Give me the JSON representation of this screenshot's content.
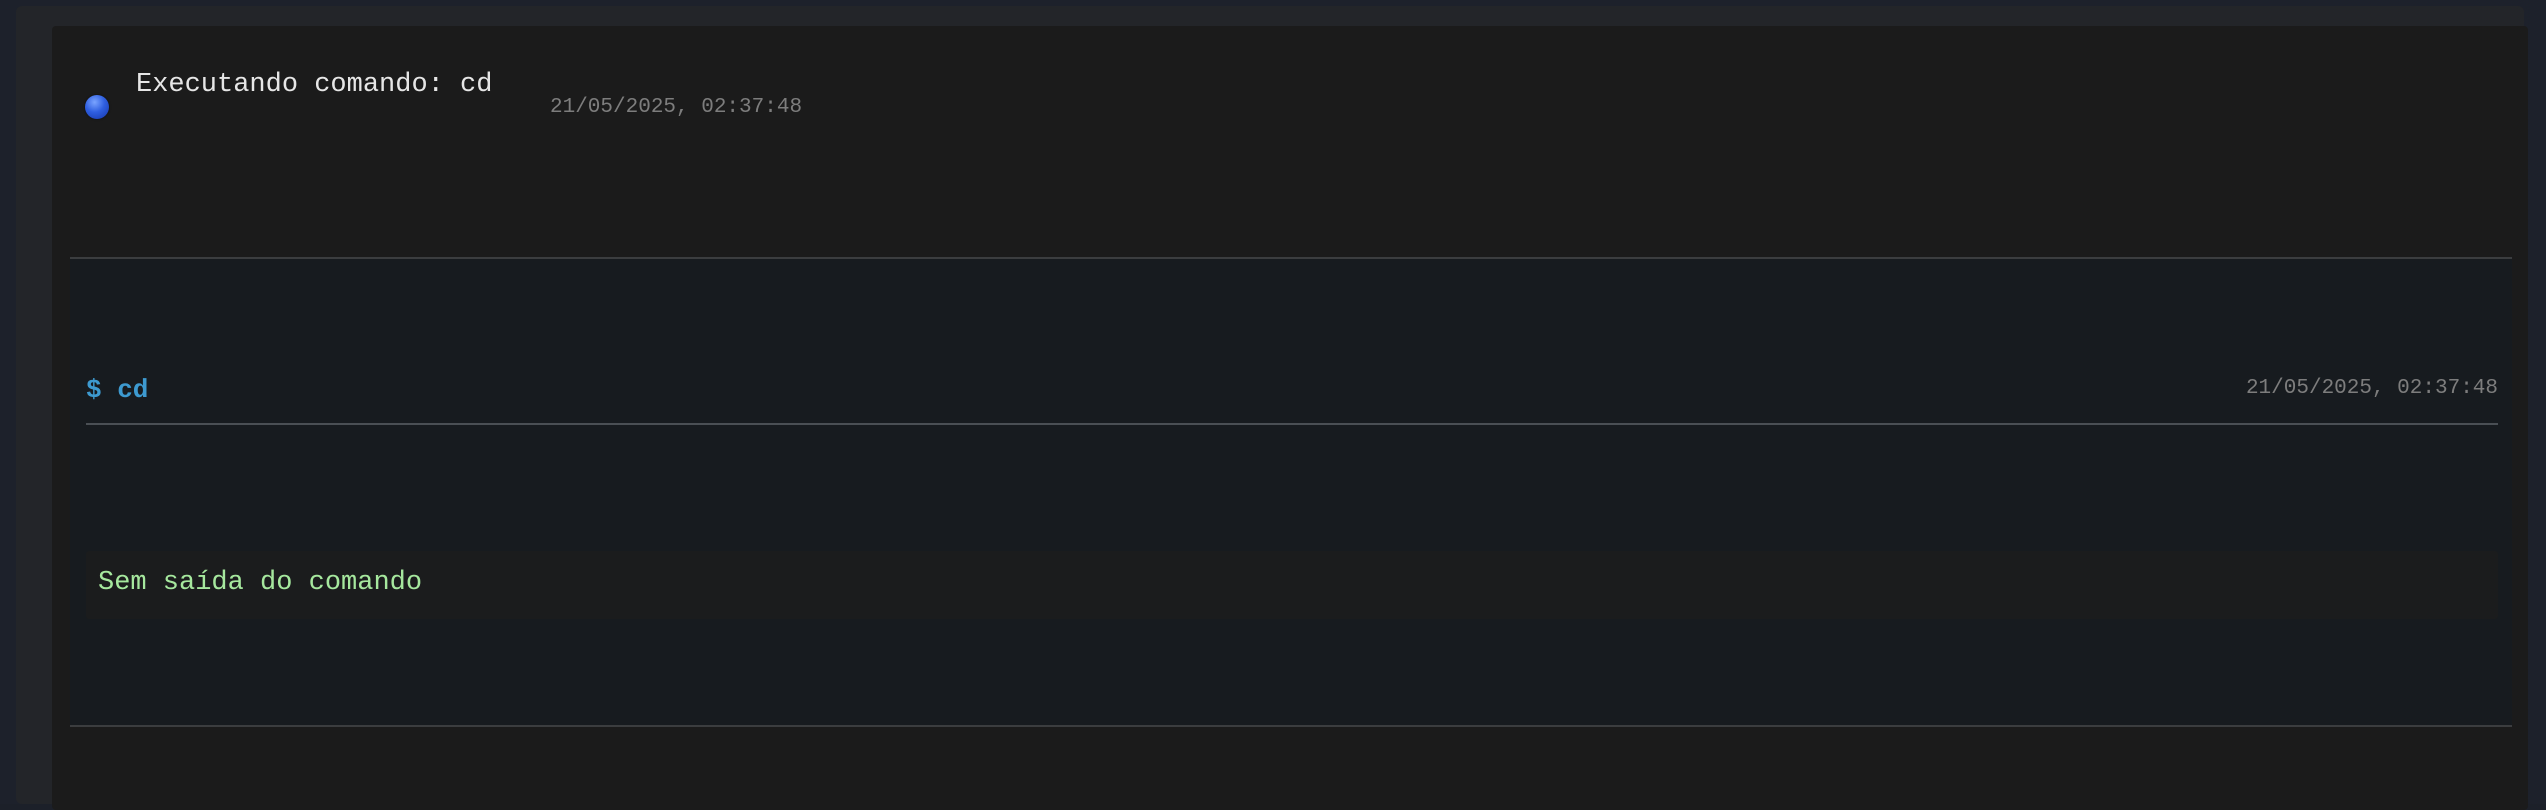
{
  "status": {
    "icon": "status-dot-icon",
    "dot_color": "#2f5fe0",
    "title": "Executando comando: cd",
    "timestamp": "21/05/2025, 02:37:48"
  },
  "command": {
    "prompt": "$ cd",
    "timestamp": "21/05/2025, 02:37:48",
    "prompt_color": "#3d9ad0"
  },
  "output": {
    "text": "Sem saída do comando",
    "text_color": "#a6e89e"
  }
}
